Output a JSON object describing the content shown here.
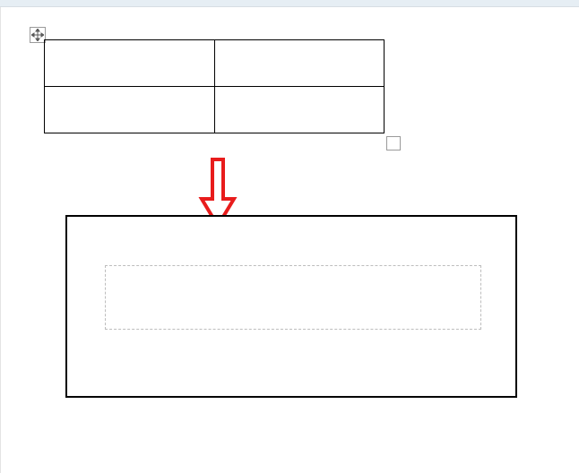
{
  "table": {
    "rows": 2,
    "cols": 2,
    "cells": [
      [
        "",
        ""
      ],
      [
        "",
        ""
      ]
    ]
  },
  "icons": {
    "move_handle": "move-icon",
    "resize_handle": "resize-icon"
  },
  "annotation": {
    "arrow_color": "#e81c1c"
  },
  "text_box": {
    "content": ""
  }
}
